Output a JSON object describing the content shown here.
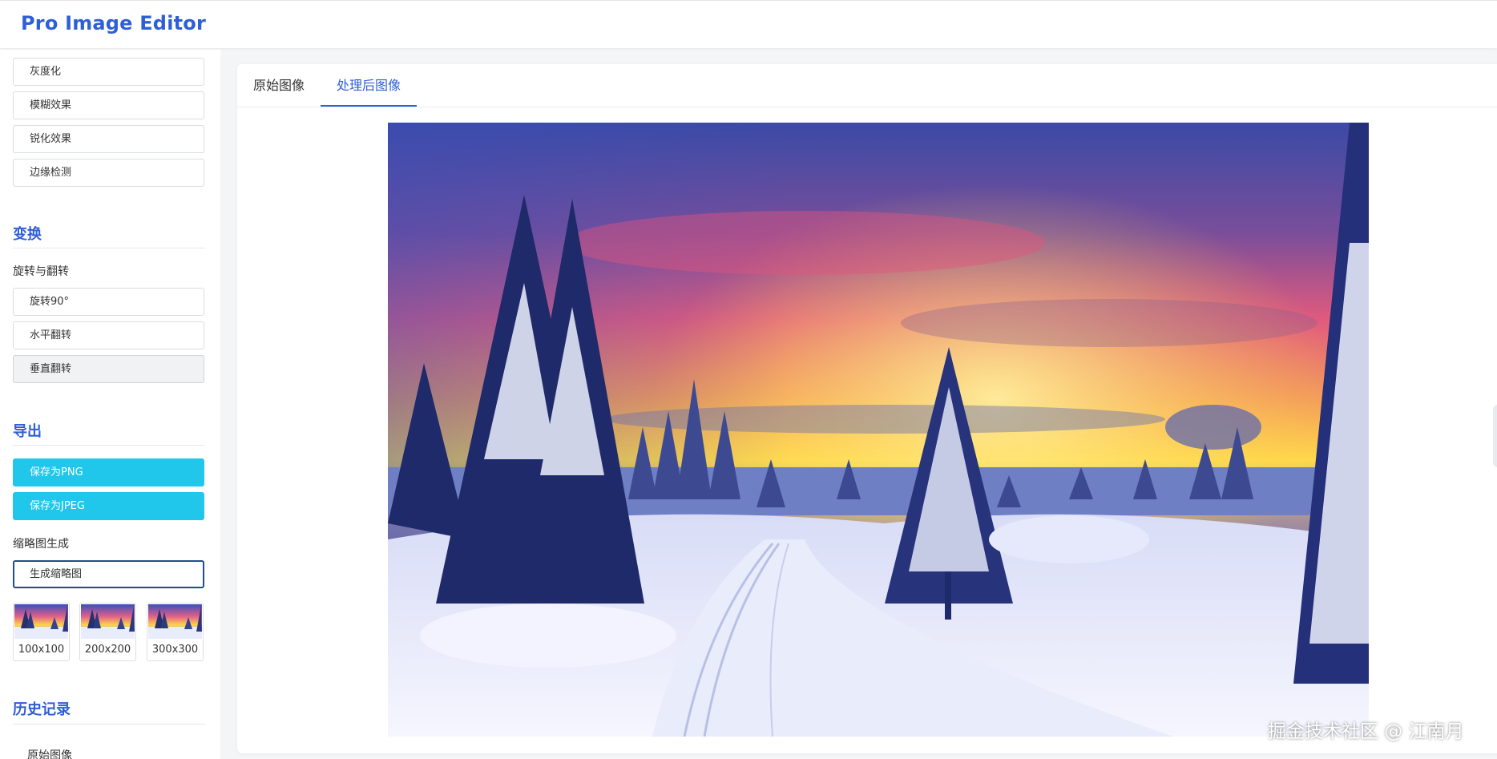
{
  "app": {
    "title": "Pro Image Editor"
  },
  "sidebar": {
    "filter_buttons": [
      "灰度化",
      "模糊效果",
      "锐化效果",
      "边缘检测"
    ],
    "transform": {
      "title": "变换",
      "subtitle": "旋转与翻转",
      "buttons": [
        "旋转90°",
        "水平翻转",
        "垂直翻转"
      ]
    },
    "export": {
      "title": "导出",
      "save_png": "保存为PNG",
      "save_jpeg": "保存为JPEG",
      "thumb_label": "缩略图生成",
      "thumb_button": "生成缩略图",
      "thumbs": [
        "100x100",
        "200x200",
        "300x300"
      ]
    },
    "history": {
      "title": "历史记录",
      "items": [
        "原始图像"
      ]
    }
  },
  "main": {
    "tabs": [
      "原始图像",
      "处理后图像"
    ],
    "active_tab": "处理后图像"
  },
  "watermark": "掘金技术社区 @ 江南月",
  "colors": {
    "accent": "#2f5fd6",
    "primary_button": "#20c7ea",
    "focus_border": "#1f4e8c"
  },
  "icons": {}
}
